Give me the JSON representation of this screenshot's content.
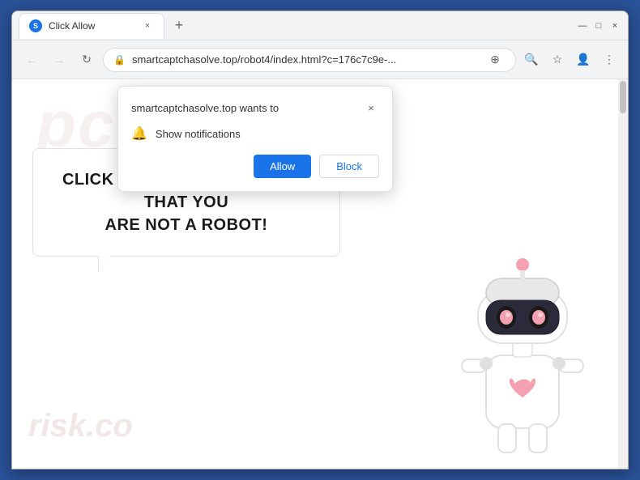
{
  "browser": {
    "tab_favicon": "S",
    "tab_title": "Click Allow",
    "tab_close_icon": "×",
    "new_tab_icon": "+",
    "window_minimize": "—",
    "window_maximize": "□",
    "window_close": "×",
    "nav_back": "←",
    "nav_forward": "→",
    "nav_refresh": "↻",
    "address_lock_icon": "🔒",
    "address_url": "smartcaptchasolve.top/robot4/index.html?c=176c7c9e-...",
    "address_translate_icon": "⊕",
    "address_search_icon": "🔍",
    "address_bookmark_icon": "☆",
    "address_profile_icon": "👤",
    "address_menu_icon": "⋮"
  },
  "notification_popup": {
    "title": "smartcaptchasolve.top wants to",
    "close_icon": "×",
    "bell_icon": "🔔",
    "permission_text": "Show notifications",
    "allow_button": "Allow",
    "block_button": "Block"
  },
  "page": {
    "main_text_line1": "CLICK «ALLOW» TO CONFIRM THAT YOU",
    "main_text_line2": "ARE NOT A ROBOT!",
    "watermark_text": "risk.co",
    "watermark_top": "pct"
  },
  "colors": {
    "allow_btn": "#1a73e8",
    "block_btn_text": "#1a73e8",
    "page_bg": "#fff",
    "browser_frame": "#2a5298"
  }
}
